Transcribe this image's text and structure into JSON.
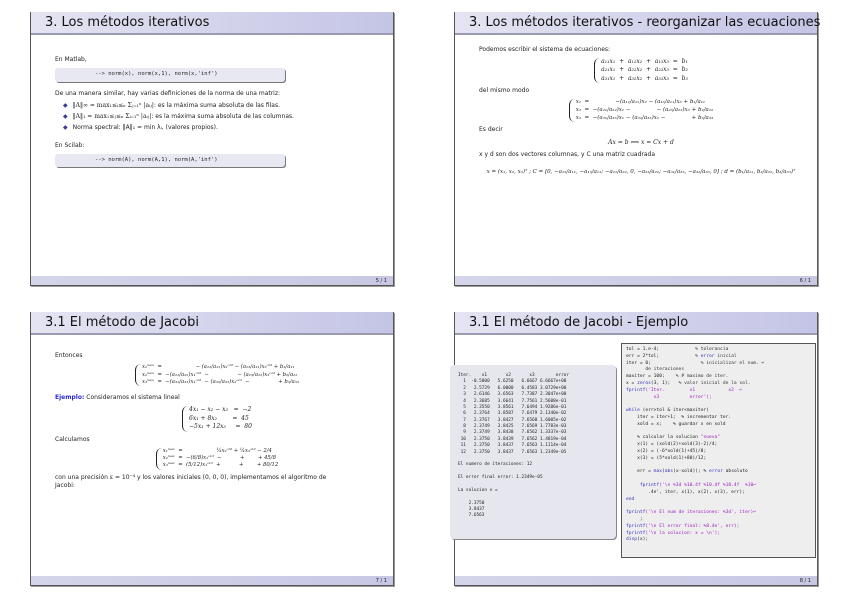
{
  "slides": [
    {
      "title": "3. Los métodos iterativos",
      "page": "5 / 1",
      "matlab_label": "En Matlab,",
      "matlab_code": "--> norm(x), norm(x,1), norm(x,'inf')",
      "intro": "De una manera similar, hay varias definiciones de la norma de una matriz:",
      "bullets": [
        {
          "math": "‖A‖∞ = max₁≤ᵢ≤ₙ Σⱼ₌₁ⁿ |aᵢⱼ|",
          "text": ": es la máxima suma absoluta de las filas."
        },
        {
          "math": "‖A‖₁ = max₁≤ⱼ≤ₙ Σᵢ₌₁ⁿ |aᵢⱼ|",
          "text": ": es la máxima suma absoluta de las columnas."
        },
        {
          "math": "Norma spectral: ‖A‖₁ = min λᵢ,",
          "text": " (valores propios)."
        }
      ],
      "scilab_label": "En Scilab:",
      "scilab_code": "--> norm(A), norm(A,1), norm(A,'inf')"
    },
    {
      "title": "3. Los métodos iterativos - reorganizar las ecuaciones",
      "page": "6 / 1",
      "p1": "Podemos escribir el sistema de ecuaciones:",
      "sys1": [
        "a₁₁x₁  +  a₁₂x₂  +  a₁₃x₃  =  b₁",
        "a₂₁x₁  +  a₂₂x₂  +  a₂₃x₃  =  b₂",
        "a₃₁x₁  +  a₃₂x₂  +  a₃₃x₃  =  b₃"
      ],
      "p2": "del mismo modo",
      "sys2": [
        "x₁  =               −(a₁₂/a₁₁)x₂ − (a₁₃/a₁₁)x₃ + b₁/a₁₁",
        "x₂  =  −(a₂₁/a₂₂)x₁ −               − (a₂₃/a₂₂)x₃ + b₂/a₂₂",
        "x₃  =  −(a₃₁/a₃₃)x₁ − (a₃₂/a₃₃)x₂ −               + b₃/a₃₃"
      ],
      "p3": "Es decir",
      "eq1": "Ax = b ⟺ x = Cx + d",
      "p4": "x y d son dos vectores columnas, y C una matriz cuadrada",
      "eq2": "x = (x₁, x₂, x₃)ᵀ ;  C = [0, −a₁₂/a₁₁, −a₁₃/a₁₁; −a₂₁/a₂₂, 0, −a₂₃/a₂₂; −a₃₁/a₃₃, −a₃₂/a₃₃, 0] ;  d = (b₁/a₁₁, b₂/a₂₂, b₃/a₃₃)ᵀ"
    },
    {
      "title": "3.1 El método de Jacobi",
      "page": "7 / 1",
      "p1": "Entonces",
      "sys1": [
        "x₁ⁿᵉʷ  =                    − (a₁₂/a₁₁)x₂ᵒˡᵈ − (a₁₃/a₁₁)x₃ᵒˡᵈ + b₁/a₁₁",
        "x₂ⁿᵉʷ  =  −(a₂₁/a₂₂)x₁ᵒˡᵈ  −                 − (a₂₃/a₂₂)x₃ᵒˡᵈ + b₂/a₂₂",
        "x₃ⁿᵉʷ  =  −(a₃₁/a₃₃)x₁ᵒˡᵈ  − (a₃₂/a₃₃)x₂ᵒˡᵈ  −                 + b₃/a₃₃"
      ],
      "example_label": "Ejemplo:",
      "example_text": " Consideramos el sistema lineal",
      "sys2": [
        "4x₁ − x₂ − x₃   =  −2",
        "6x₁ + 8x₂        =  45",
        "−5x₁ + 12x₃     =  80"
      ],
      "p2": "Calculamos",
      "sys3": [
        "x₁ⁿᵉʷ  =                    ¼x₂ᵒˡᵈ + ¼x₃ᵒˡᵈ − 2/4",
        "x₂ⁿᵉʷ  =  −(6/8)x₁ᵒˡᵈ  −           +        + 45/8",
        "x₃ⁿᵉʷ  =  (5/12)x₁ᵒˡᵈ  +           +        + 80/12"
      ],
      "p3": "con una precisión ε = 10⁻⁴ y los valores iniciales (0, 0, 0), implementamos el algoritmo de Jacobi:"
    },
    {
      "title": "3.1 El método de Jacobi - Ejemplo",
      "page": "8 / 1",
      "output_lines": [
        "Iter.    x1       x2       x3        error",
        "  1  -0.5000   5.6250   6.6667 6.6667e+00",
        "  2   2.5729   6.0000   6.4583 3.0729e+00",
        "  3   2.6146   3.6563   7.7387 2.3047e+00",
        "  4   2.3685   3.6641   7.7561 2.5608e-01",
        "  5   2.3550   3.8561   7.6494 1.9206e-01",
        "  6   2.3764   3.8587   7.6479 2.1340e-02",
        "  7   2.3767   3.8427   7.6568 1.6005e-02",
        "  8   2.3749   3.8425   7.6569 1.7783e-03",
        "  9   2.3749   3.8438   7.6562 1.3337e-03",
        " 10   2.3750   3.8439   7.6562 1.4819e-04",
        " 11   2.3750   3.8437   7.6563 1.1114e-04",
        " 12   2.3750   3.8437   7.6563 1.2349e-05",
        "",
        "El numero de iteraciones: 12",
        "",
        "El error final error: 1.2349e-05",
        "",
        "La solucion x =",
        "",
        "    2.3750",
        "    3.8437",
        "    7.6563"
      ],
      "code_lines": [
        [
          [
            "tol = 1.e-4;             ",
            ""
          ],
          [
            "% tolerancia",
            "cm"
          ]
        ],
        [
          [
            "err = 2*tol;             ",
            ""
          ],
          [
            "% ",
            "cm"
          ],
          [
            "error",
            "kw"
          ],
          [
            " inicial",
            "cm"
          ]
        ],
        [
          [
            "iter = 0;                  ",
            ""
          ],
          [
            "% inicializar el num. ↩",
            "cm"
          ]
        ],
        [
          [
            "       de iteraciones",
            "cm"
          ]
        ],
        [
          [
            "maxiter = 100;    ",
            ""
          ],
          [
            "% # maximo de iter.",
            "cm"
          ]
        ],
        [
          [
            "x = ",
            ""
          ],
          [
            "zeros",
            "kw"
          ],
          [
            "(3, 1);   ",
            ""
          ],
          [
            "% valor inicial de la sol.",
            "cm"
          ]
        ],
        [
          [
            "fprintf",
            "kw"
          ],
          [
            "('Iter.         x1            x2  ↩",
            "str"
          ]
        ],
        [
          [
            "          x3           error');",
            "str"
          ]
        ],
        [
          [
            "",
            ""
          ]
        ],
        [
          [
            "while",
            "kw"
          ],
          [
            " (err>tol & iter<maxiter)",
            ""
          ]
        ],
        [
          [
            "    iter = iter+1;  % incrementar ter.",
            ""
          ]
        ],
        [
          [
            "    xold = x;    % guardar x en xold",
            ""
          ]
        ],
        [
          [
            "",
            ""
          ]
        ],
        [
          [
            "    % calcular la solucion ",
            ""
          ],
          [
            "\"nueva\"",
            "str"
          ]
        ],
        [
          [
            "    x(1) = (xold(2)+xold(3)-2)/4;",
            ""
          ]
        ],
        [
          [
            "    x(2) = (-6*xold(1)+45)/8;",
            ""
          ]
        ],
        [
          [
            "    x(3) = (5*xold(1)+80)/12;",
            ""
          ]
        ],
        [
          [
            "",
            ""
          ]
        ],
        [
          [
            "    err = ",
            ""
          ],
          [
            "max",
            "kw"
          ],
          [
            "(",
            ""
          ],
          [
            "abs",
            "kw"
          ],
          [
            "(x-xold)); % ",
            ""
          ],
          [
            "error",
            "kw"
          ],
          [
            " absoluto",
            ""
          ]
        ],
        [
          [
            "",
            ""
          ]
        ],
        [
          [
            "     fprintf",
            "kw"
          ],
          [
            "('\\n %3d %10.4f %10.4f %10.4f  %10↩",
            "str"
          ]
        ],
        [
          [
            "        .4e', iter, x(1), x(2), x(3), err);",
            ""
          ]
        ],
        [
          [
            "end",
            "kw"
          ]
        ],
        [
          [
            "",
            ""
          ]
        ],
        [
          [
            "fprintf",
            "kw"
          ],
          [
            "('\\n El num de iteraciones: %3d', iter)↩",
            "str"
          ]
        ],
        [
          [
            "     ;",
            ""
          ]
        ],
        [
          [
            "fprintf",
            "kw"
          ],
          [
            "('\\n El error final: %8.4e', err);",
            "str"
          ]
        ],
        [
          [
            "fprintf",
            "kw"
          ],
          [
            "('\\n la solucion: x = \\n');",
            "str"
          ]
        ],
        [
          [
            "disp",
            "kw"
          ],
          [
            "(x);",
            ""
          ]
        ]
      ]
    }
  ],
  "colors": {
    "accent": "#2a2ad8",
    "title_bar": "#c4c4e6"
  }
}
